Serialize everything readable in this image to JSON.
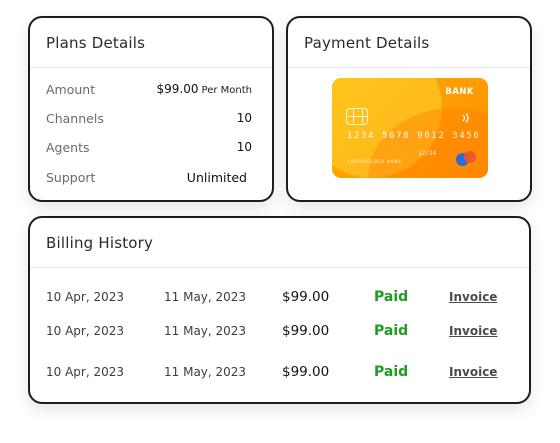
{
  "plans": {
    "title": "Plans Details",
    "items": [
      {
        "label": "Amount",
        "value": "$99.00",
        "suffix": "Per Month"
      },
      {
        "label": "Channels",
        "value": "10"
      },
      {
        "label": "Agents",
        "value": "10"
      },
      {
        "label": "Support",
        "value": "Unlimited"
      }
    ]
  },
  "payment": {
    "title": "Payment Details",
    "card": {
      "bank": "BANK",
      "number": "1234 5678 9012 3456",
      "holder": "CARDHOLDER NAME",
      "expiry": "12/24",
      "colors": {
        "primary": "#ffa000",
        "logo_left": "#2e6bd6",
        "logo_right": "#f0522e"
      },
      "icons": {
        "chip": "chip-icon",
        "contactless": "contactless-icon",
        "network": "card-network-logo"
      }
    }
  },
  "billing": {
    "title": "Billing History",
    "rows": [
      {
        "start": "10 Apr, 2023",
        "end": "11 May, 2023",
        "amount": "$99.00",
        "status": "Paid",
        "invoice": "Invoice"
      },
      {
        "start": "10 Apr, 2023",
        "end": "11 May, 2023",
        "amount": "$99.00",
        "status": "Paid",
        "invoice": "Invoice"
      },
      {
        "start": "10 Apr, 2023",
        "end": "11 May, 2023",
        "amount": "$99.00",
        "status": "Paid",
        "invoice": "Invoice"
      }
    ],
    "status_color": "#1f9d1f"
  }
}
